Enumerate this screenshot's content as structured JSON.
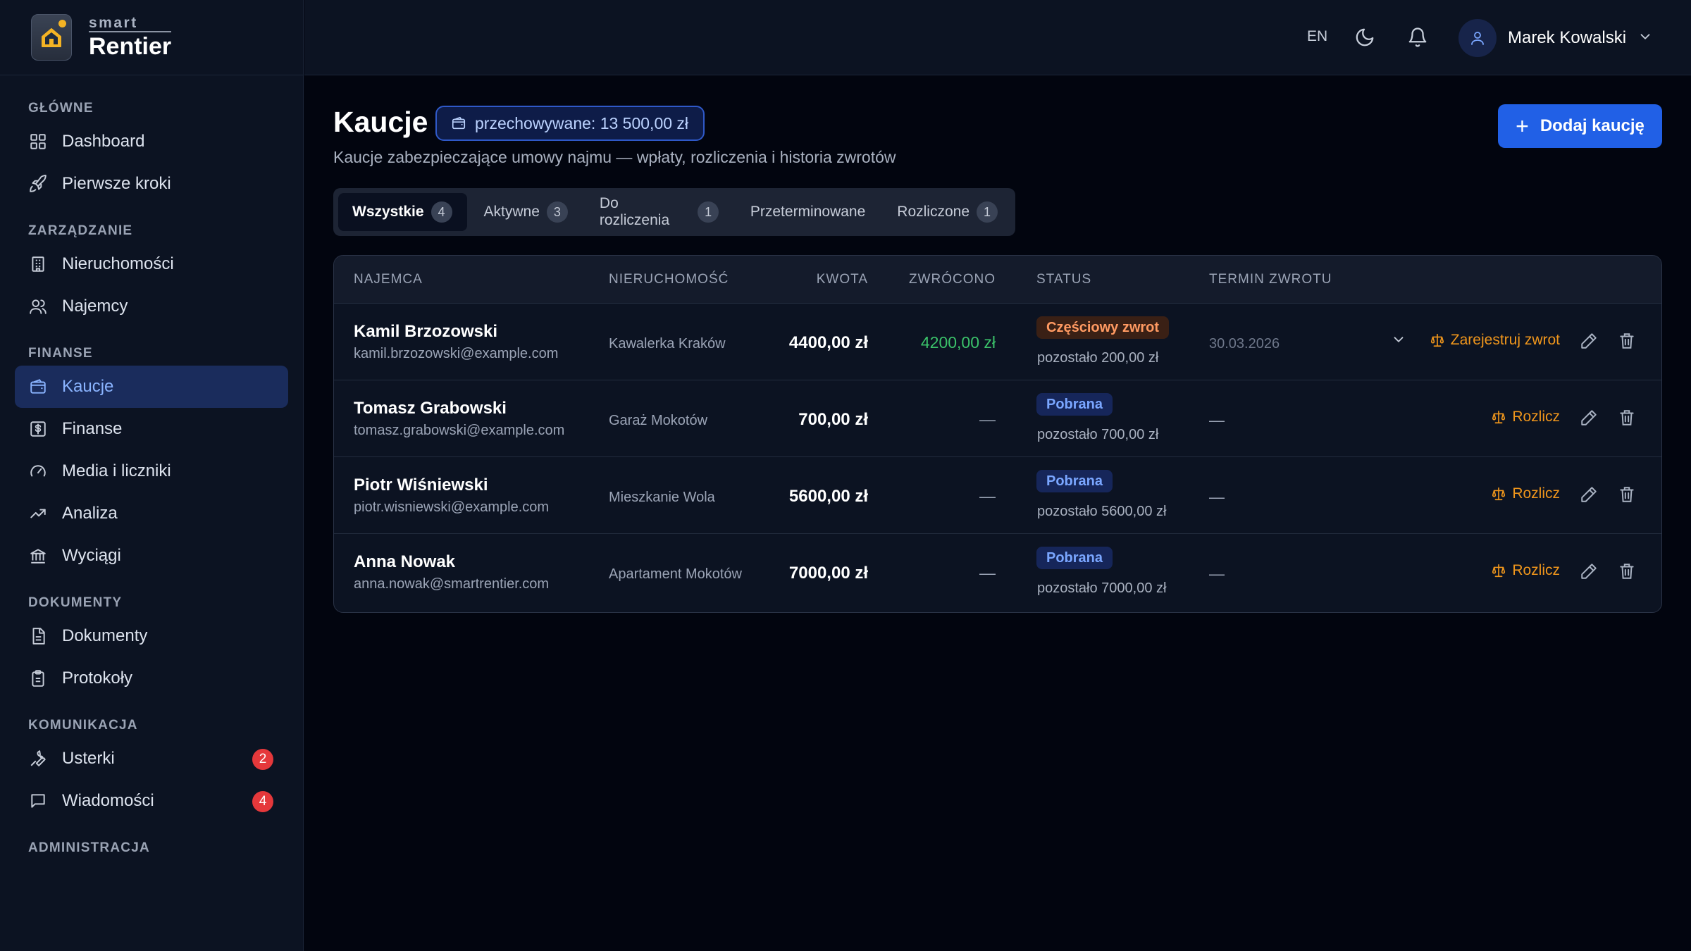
{
  "brand": {
    "small": "smart",
    "big": "Rentier"
  },
  "sidebar": {
    "sections": [
      {
        "title": "GŁÓWNE",
        "items": [
          {
            "label": "Dashboard",
            "icon": "grid-icon"
          },
          {
            "label": "Pierwsze kroki",
            "icon": "rocket-icon"
          }
        ]
      },
      {
        "title": "ZARZĄDZANIE",
        "items": [
          {
            "label": "Nieruchomości",
            "icon": "building-icon"
          },
          {
            "label": "Najemcy",
            "icon": "users-icon"
          }
        ]
      },
      {
        "title": "FINANSE",
        "items": [
          {
            "label": "Kaucje",
            "icon": "wallet-icon",
            "active": true
          },
          {
            "label": "Finanse",
            "icon": "dollar-icon"
          },
          {
            "label": "Media i liczniki",
            "icon": "gauge-icon"
          },
          {
            "label": "Analiza",
            "icon": "trend-icon"
          },
          {
            "label": "Wyciągi",
            "icon": "bank-icon"
          }
        ]
      },
      {
        "title": "DOKUMENTY",
        "items": [
          {
            "label": "Dokumenty",
            "icon": "document-icon"
          },
          {
            "label": "Protokoły",
            "icon": "clipboard-icon"
          }
        ]
      },
      {
        "title": "KOMUNIKACJA",
        "items": [
          {
            "label": "Usterki",
            "icon": "wrench-icon",
            "badge": "2"
          },
          {
            "label": "Wiadomości",
            "icon": "chat-icon",
            "badge": "4"
          }
        ]
      },
      {
        "title": "ADMINISTRACJA",
        "items": []
      }
    ]
  },
  "topbar": {
    "lang": "EN",
    "user_name": "Marek Kowalski"
  },
  "page": {
    "title": "Kaucje",
    "stored_label": "przechowywane: 13 500,00 zł",
    "subtitle": "Kaucje zabezpieczające umowy najmu — wpłaty, rozliczenia i historia zwrotów",
    "add_button": "Dodaj kaucję"
  },
  "tabs": [
    {
      "label": "Wszystkie",
      "count": "4",
      "active": true
    },
    {
      "label": "Aktywne",
      "count": "3"
    },
    {
      "label": "Do rozliczenia",
      "count": "1"
    },
    {
      "label": "Przeterminowane",
      "count": null
    },
    {
      "label": "Rozliczone",
      "count": "1"
    }
  ],
  "table": {
    "headers": {
      "tenant": "NAJEMCA",
      "property": "NIERUCHOMOŚĆ",
      "amount": "KWOTA",
      "returned": "ZWRÓCONO",
      "status": "STATUS",
      "due": "TERMIN ZWROTU"
    },
    "rows": [
      {
        "name": "Kamil Brzozowski",
        "email": "kamil.brzozowski@example.com",
        "property": "Kawalerka Kraków",
        "amount": "4400,00 zł",
        "returned": "4200,00 zł",
        "status": "Częściowy zwrot",
        "status_type": "partial",
        "remaining": "pozostało 200,00 zł",
        "due": "30.03.2026",
        "action": "Zarejestruj zwrot",
        "expandable": true
      },
      {
        "name": "Tomasz Grabowski",
        "email": "tomasz.grabowski@example.com",
        "property": "Garaż Mokotów",
        "amount": "700,00 zł",
        "returned": "—",
        "status": "Pobrana",
        "status_type": "taken",
        "remaining": "pozostało 700,00 zł",
        "due": "—",
        "action": "Rozlicz",
        "expandable": false
      },
      {
        "name": "Piotr Wiśniewski",
        "email": "piotr.wisniewski@example.com",
        "property": "Mieszkanie Wola",
        "amount": "5600,00 zł",
        "returned": "—",
        "status": "Pobrana",
        "status_type": "taken",
        "remaining": "pozostało 5600,00 zł",
        "due": "—",
        "action": "Rozlicz",
        "expandable": false
      },
      {
        "name": "Anna Nowak",
        "email": "anna.nowak@smartrentier.com",
        "property": "Apartament Mokotów",
        "amount": "7000,00 zł",
        "returned": "—",
        "status": "Pobrana",
        "status_type": "taken",
        "remaining": "pozostało 7000,00 zł",
        "due": "—",
        "action": "Rozlicz",
        "expandable": false
      }
    ]
  },
  "colors": {
    "accent": "#2160e6",
    "active_nav": "#1a2c5c",
    "orange": "#f0961c",
    "green": "#3bc26a",
    "badge_red": "#e5383b"
  }
}
